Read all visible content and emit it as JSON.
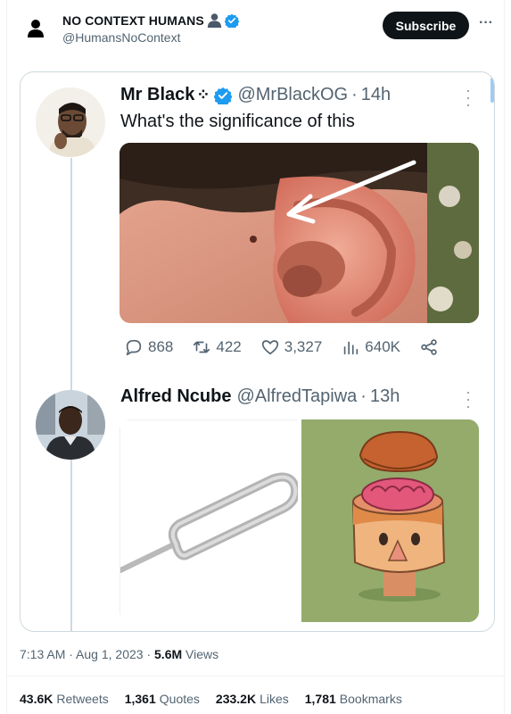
{
  "account": {
    "name": "NO CONTEXT HUMANS",
    "handle": "@HumansNoContext",
    "subscribe_label": "Subscribe"
  },
  "quoted_tweet": {
    "author": "Mr Black",
    "author_glyph": "⁘",
    "handle": "@MrBlackOG",
    "age": "14h",
    "text": "What's the significance of this",
    "image_icon": "ear-photo-with-arrow",
    "actions": {
      "replies": "868",
      "retweets": "422",
      "likes": "3,327",
      "views": "640K"
    }
  },
  "reply_tweet": {
    "author": "Alfred Ncube",
    "handle": "@AlfredTapiwa",
    "age": "13h",
    "images": [
      "sim-ejector-pin",
      "open-head-brain-cartoon"
    ]
  },
  "footer": {
    "time": "7:13 AM",
    "date": "Aug 1, 2023",
    "views_count": "5.6M",
    "views_label": "Views",
    "stats": [
      {
        "count": "43.6K",
        "label": "Retweets"
      },
      {
        "count": "1,361",
        "label": "Quotes"
      },
      {
        "count": "233.2K",
        "label": "Likes"
      },
      {
        "count": "1,781",
        "label": "Bookmarks"
      }
    ]
  },
  "colors": {
    "verified": "#1d9bf0",
    "text_primary": "#0f1419",
    "text_secondary": "#536471",
    "subscribe_bg": "#0f1419"
  }
}
